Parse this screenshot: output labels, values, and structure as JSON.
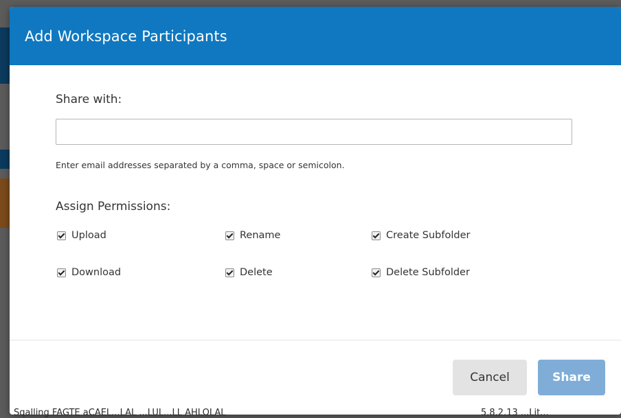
{
  "background": {
    "footer_text": "Sqalling FAGTE aCAEL...LAL ...LUL...LL AHLOLAL",
    "footer_right": "5.8.2.13  ...Lit..."
  },
  "dialog": {
    "title": "Add Workspace Participants",
    "share_with_label": "Share with:",
    "share_input_value": "",
    "share_input_placeholder": "",
    "hint": "Enter email addresses separated by a comma, space or semicolon.",
    "permissions_label": "Assign Permissions:",
    "permissions": [
      {
        "label": "Upload",
        "checked": true
      },
      {
        "label": "Rename",
        "checked": true
      },
      {
        "label": "Create Subfolder",
        "checked": true
      },
      {
        "label": "Download",
        "checked": true
      },
      {
        "label": "Delete",
        "checked": true
      },
      {
        "label": "Delete Subfolder",
        "checked": true
      }
    ],
    "cancel_label": "Cancel",
    "share_label": "Share"
  },
  "colors": {
    "header": "#0f78c0",
    "share_button": "#7fadd8",
    "cancel_button": "#e3e3e3"
  }
}
